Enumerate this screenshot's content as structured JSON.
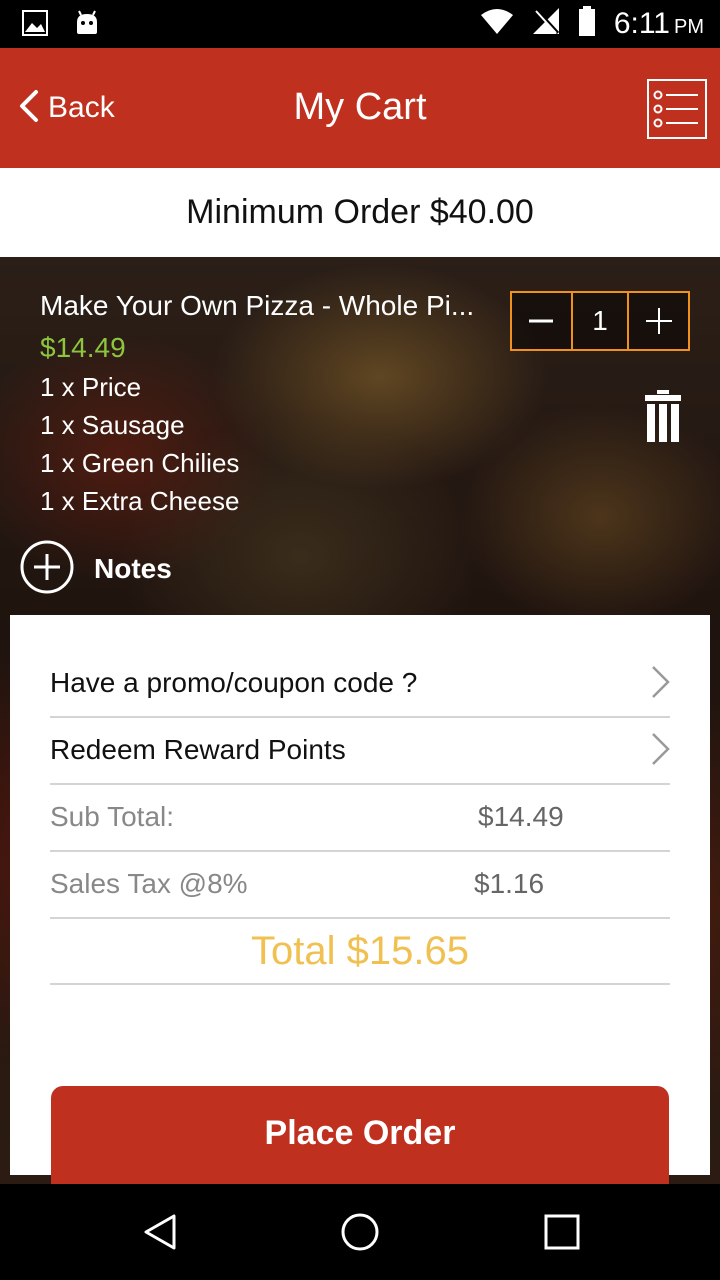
{
  "status_bar": {
    "time": "6:11",
    "ampm": "PM",
    "icons": [
      "image-icon",
      "android-icon",
      "wifi-icon",
      "signal-off-icon",
      "battery-icon"
    ]
  },
  "header": {
    "back_label": "Back",
    "title": "My Cart",
    "menu_icon": "menu-list-icon",
    "color": "#c0301f"
  },
  "minimum_order": "Minimum Order $40.00",
  "cart_item": {
    "name": "Make Your Own Pizza - Whole Pi...",
    "price": "$14.49",
    "quantity": "1",
    "modifiers": [
      "1 x Price",
      "1 x Sausage",
      "1 x Green Chilies",
      "1 x Extra Cheese"
    ],
    "notes_label": "Notes"
  },
  "summary": {
    "promo_label": "Have a promo/coupon code ?",
    "reward_label": "Redeem Reward Points",
    "subtotal_label": "Sub Total:",
    "subtotal_value": "$14.49",
    "tax_label": "Sales Tax @8%",
    "tax_value": "$1.16",
    "total": "Total $15.65"
  },
  "place_order_label": "Place Order",
  "colors": {
    "accent": "#c0301f",
    "price_green": "#8cc63f",
    "stepper_orange": "#f0901e",
    "total_gold": "#f0c050"
  }
}
